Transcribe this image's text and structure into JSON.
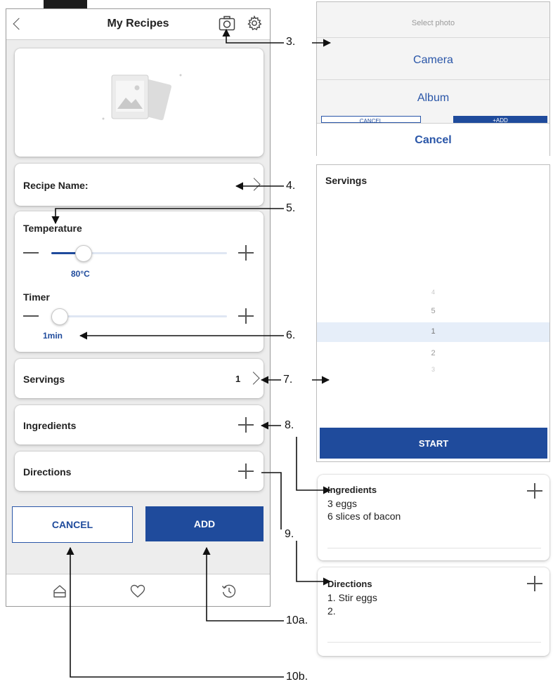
{
  "app": {
    "title": "My Recipes",
    "recipe_name_label": "Recipe Name:",
    "temperature": {
      "label": "Temperature",
      "value_text": "80°C",
      "level": 0.18
    },
    "timer": {
      "label": "Timer",
      "value_text": "1min",
      "level": 0.0
    },
    "servings": {
      "label": "Servings",
      "value": "1"
    },
    "ingredients_label": "Ingredients",
    "directions_label": "Directions",
    "cancel_label": "CANCEL",
    "add_label": "ADD",
    "nav": [
      "home-icon",
      "heart-icon",
      "history-icon"
    ],
    "colors": {
      "primary": "#1f4b9c",
      "accent": "#2a56a8"
    }
  },
  "photo_sheet": {
    "title": "Select photo",
    "options": [
      "Camera",
      "Album"
    ],
    "behind_left": "CANCEL",
    "behind_right": "+ADD",
    "cancel": "Cancel"
  },
  "servings_picker": {
    "title": "Servings",
    "rows": [
      "4",
      "5",
      "1",
      "2",
      "3"
    ],
    "selected": "1",
    "start_label": "START"
  },
  "ingredients_card": {
    "title": "Ingredients",
    "lines": [
      "3 eggs",
      "6 slices of bacon"
    ]
  },
  "directions_card": {
    "title": "Directions",
    "lines": [
      "1. Stir eggs",
      "2."
    ]
  },
  "callouts": [
    "3.",
    "4.",
    "5.",
    "6.",
    "7.",
    "8.",
    "9.",
    "10a.",
    "10b."
  ]
}
